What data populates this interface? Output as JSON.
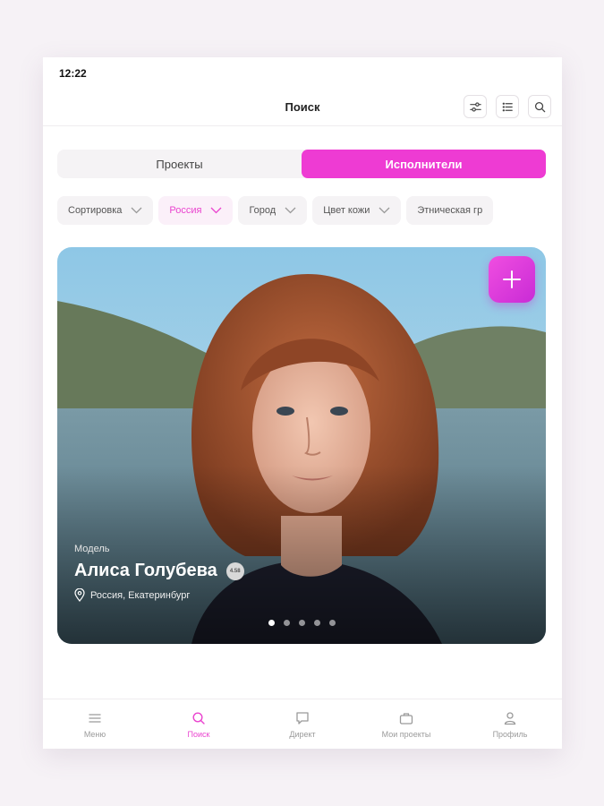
{
  "status": {
    "time": "12:22"
  },
  "nav": {
    "title": "Поиск",
    "icons": [
      "filter-sliders-icon",
      "list-icon",
      "search-icon"
    ]
  },
  "segments": {
    "projects": "Проекты",
    "performers": "Исполнители",
    "active": "performers"
  },
  "filters": [
    {
      "label": "Сортировка",
      "active": false
    },
    {
      "label": "Россия",
      "active": true
    },
    {
      "label": "Город",
      "active": false
    },
    {
      "label": "Цвет кожи",
      "active": false
    },
    {
      "label": "Этническая гр",
      "active": false
    }
  ],
  "card": {
    "role": "Модель",
    "name": "Алиса Голубева",
    "rating": "4.58",
    "location": "Россия, Екатеринбург",
    "photo_index": 1,
    "photo_count": 5
  },
  "tabbar": [
    {
      "label": "Меню",
      "icon": "menu-icon",
      "active": false
    },
    {
      "label": "Поиск",
      "icon": "search-icon",
      "active": true
    },
    {
      "label": "Директ",
      "icon": "chat-icon",
      "active": false
    },
    {
      "label": "Мои проекты",
      "icon": "briefcase-icon",
      "active": false
    },
    {
      "label": "Профиль",
      "icon": "profile-icon",
      "active": false
    }
  ],
  "colors": {
    "accent": "#ee3bd3",
    "background": "#f6f2f6"
  }
}
